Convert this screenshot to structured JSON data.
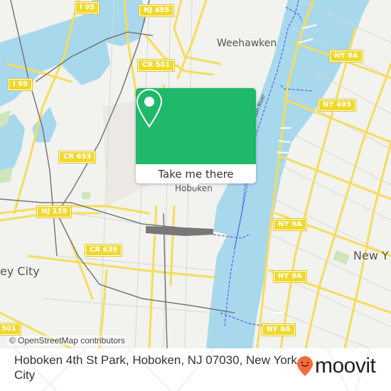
{
  "map": {
    "attribution": "© OpenStreetMap contributors",
    "place_labels": [
      {
        "id": "weehawken",
        "text": "Weehawken"
      },
      {
        "id": "hoboken",
        "text": "Hoboken"
      },
      {
        "id": "new-york",
        "text": "New Y"
      },
      {
        "id": "jersey-city",
        "text": "ey City"
      }
    ],
    "river_label": "Hudson River",
    "road_shields": [
      {
        "id": "i95-top",
        "text": "I 95"
      },
      {
        "id": "nj495",
        "text": "NJ 495"
      },
      {
        "id": "cr501-top",
        "text": "CR 501"
      },
      {
        "id": "i95-left",
        "text": "I 95"
      },
      {
        "id": "ny9a-1",
        "text": "NY 9A"
      },
      {
        "id": "ny495",
        "text": "NY 495"
      },
      {
        "id": "cr653",
        "text": "CR 653"
      },
      {
        "id": "nj139",
        "text": "NJ 139"
      },
      {
        "id": "ny9a-2",
        "text": "NY 9A"
      },
      {
        "id": "cr639",
        "text": "CR 639"
      },
      {
        "id": "ny9a-3",
        "text": "NY 9A"
      },
      {
        "id": "ny9a-4",
        "text": "NY 9A"
      },
      {
        "id": "cr501-bottom",
        "text": "501"
      }
    ],
    "colors": {
      "water": "#a8d8ec",
      "land": "#f2f2ef",
      "road": "#f6dd5a",
      "rail": "#777777",
      "ferry": "#5a6cf0",
      "park": "#cfe6bd"
    }
  },
  "popup": {
    "action_label": "Take me there",
    "icon": "map-pin-icon",
    "accent_color": "#20b86a"
  },
  "footer": {
    "address": "Hoboken 4th St Park, Hoboken, NJ 07030, New York City",
    "brand": "moovit",
    "brand_color": "#f26b3a"
  }
}
